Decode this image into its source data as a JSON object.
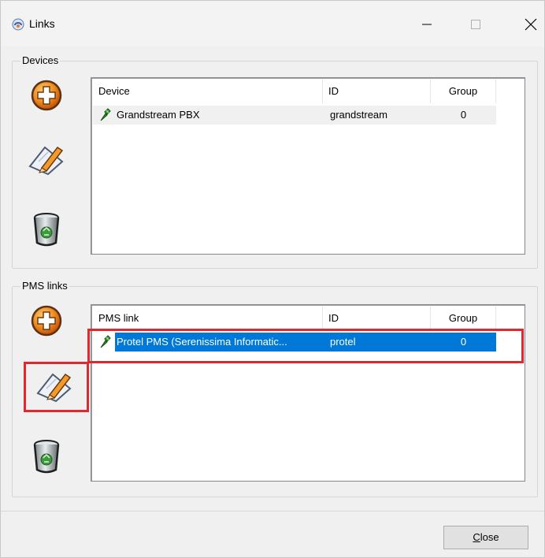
{
  "window": {
    "title": "Links"
  },
  "devices": {
    "group_label": "Devices",
    "columns": [
      "Device",
      "ID",
      "Group"
    ],
    "rows": [
      {
        "name": "Grandstream PBX",
        "id": "grandstream",
        "group": "0"
      }
    ]
  },
  "pms": {
    "group_label": "PMS links",
    "columns": [
      "PMS link",
      "ID",
      "Group"
    ],
    "rows": [
      {
        "name": "Protel PMS (Serenissima Informatic...",
        "id": "protel",
        "group": "0",
        "selected": true
      }
    ]
  },
  "footer": {
    "close_label_first": "C",
    "close_label_rest": "lose"
  },
  "icons": {
    "app": "links-app-icon",
    "add": "add-icon",
    "edit": "edit-icon",
    "delete": "trash-icon",
    "row": "plug-icon"
  },
  "colors": {
    "selection": "#0078d7",
    "highlight": "#e0282f"
  }
}
